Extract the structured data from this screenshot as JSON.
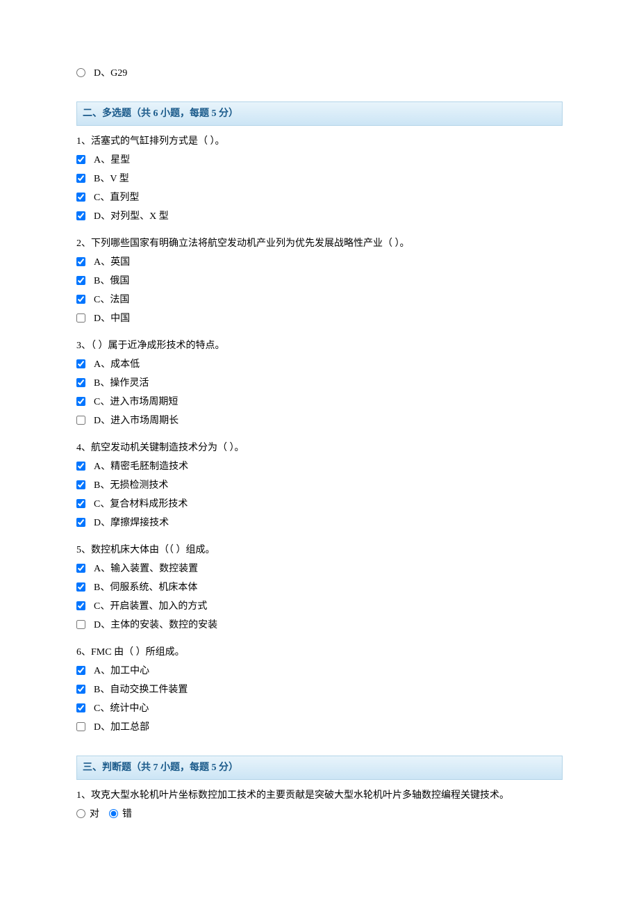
{
  "prev_question_option": {
    "label": "D、G29"
  },
  "section2": {
    "title": "二、多选题（共 6 小题，每题 5 分）",
    "questions": [
      {
        "text": "1、活塞式的气缸排列方式是（ ）。",
        "options": [
          {
            "label": "A、星型",
            "checked": true
          },
          {
            "label": "B、V 型",
            "checked": true
          },
          {
            "label": "C、直列型",
            "checked": true
          },
          {
            "label": "D、对列型、X 型",
            "checked": true
          }
        ]
      },
      {
        "text": "2、下列哪些国家有明确立法将航空发动机产业列为优先发展战略性产业（ ）。",
        "options": [
          {
            "label": "A、英国",
            "checked": true
          },
          {
            "label": "B、俄国",
            "checked": true
          },
          {
            "label": "C、法国",
            "checked": true
          },
          {
            "label": "D、中国",
            "checked": false
          }
        ]
      },
      {
        "text": "3、（ ）属于近净成形技术的特点。",
        "options": [
          {
            "label": "A、成本低",
            "checked": true
          },
          {
            "label": "B、操作灵活",
            "checked": true
          },
          {
            "label": "C、进入市场周期短",
            "checked": true
          },
          {
            "label": "D、进入市场周期长",
            "checked": false
          }
        ]
      },
      {
        "text": "4、航空发动机关键制造技术分为（ ）。",
        "options": [
          {
            "label": "A、精密毛胚制造技术",
            "checked": true
          },
          {
            "label": "B、无损检测技术",
            "checked": true
          },
          {
            "label": "C、复合材料成形技术",
            "checked": true
          },
          {
            "label": "D、摩擦焊接技术",
            "checked": true
          }
        ]
      },
      {
        "text": "5、数控机床大体由（（ ）组成。",
        "options": [
          {
            "label": "A、输入装置、数控装置",
            "checked": true
          },
          {
            "label": "B、伺服系统、机床本体",
            "checked": true
          },
          {
            "label": "C、开启装置、加入的方式",
            "checked": true
          },
          {
            "label": "D、主体的安装、数控的安装",
            "checked": false
          }
        ]
      },
      {
        "text": "6、FMC 由（ ）所组成。",
        "options": [
          {
            "label": "A、加工中心",
            "checked": true
          },
          {
            "label": "B、自动交换工件装置",
            "checked": true
          },
          {
            "label": "C、统计中心",
            "checked": true
          },
          {
            "label": "D、加工总部",
            "checked": false
          }
        ]
      }
    ]
  },
  "section3": {
    "title": "三、判断题（共 7 小题，每题 5 分）",
    "questions": [
      {
        "text": "1、攻克大型水轮机叶片坐标数控加工技术的主要贡献是突破大型水轮机叶片多轴数控编程关键技术。",
        "true_label": "对",
        "false_label": "错",
        "selected": "false"
      }
    ]
  }
}
